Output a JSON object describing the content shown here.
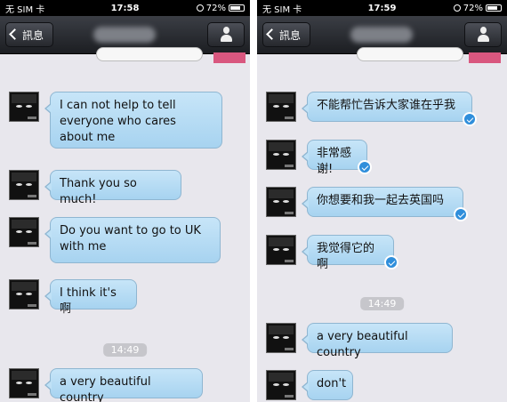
{
  "left_phone": {
    "status": {
      "carrier": "无 SIM 卡",
      "time": "17:58",
      "battery": "72%",
      "battery_level": 0.72
    },
    "nav": {
      "back_label": "訊息"
    },
    "messages": [
      {
        "text": "I can not help to tell everyone who cares about me"
      },
      {
        "text": "Thank you so much!"
      },
      {
        "text": "Do you want to go to UK with me"
      },
      {
        "text": "I think it's 啊"
      },
      {
        "text": "a very beautiful country"
      }
    ],
    "timestamp": "14:49"
  },
  "right_phone": {
    "status": {
      "carrier": "无 SIM 卡",
      "time": "17:59",
      "battery": "72%",
      "battery_level": 0.72
    },
    "nav": {
      "back_label": "訊息"
    },
    "messages": [
      {
        "text": "不能帮忙告诉大家谁在乎我"
      },
      {
        "text": "非常感谢!"
      },
      {
        "text": "你想要和我一起去英国吗"
      },
      {
        "text": "我觉得它的啊"
      },
      {
        "text": "a very beautiful country"
      },
      {
        "text": "don't"
      }
    ],
    "timestamp": "14:49"
  }
}
